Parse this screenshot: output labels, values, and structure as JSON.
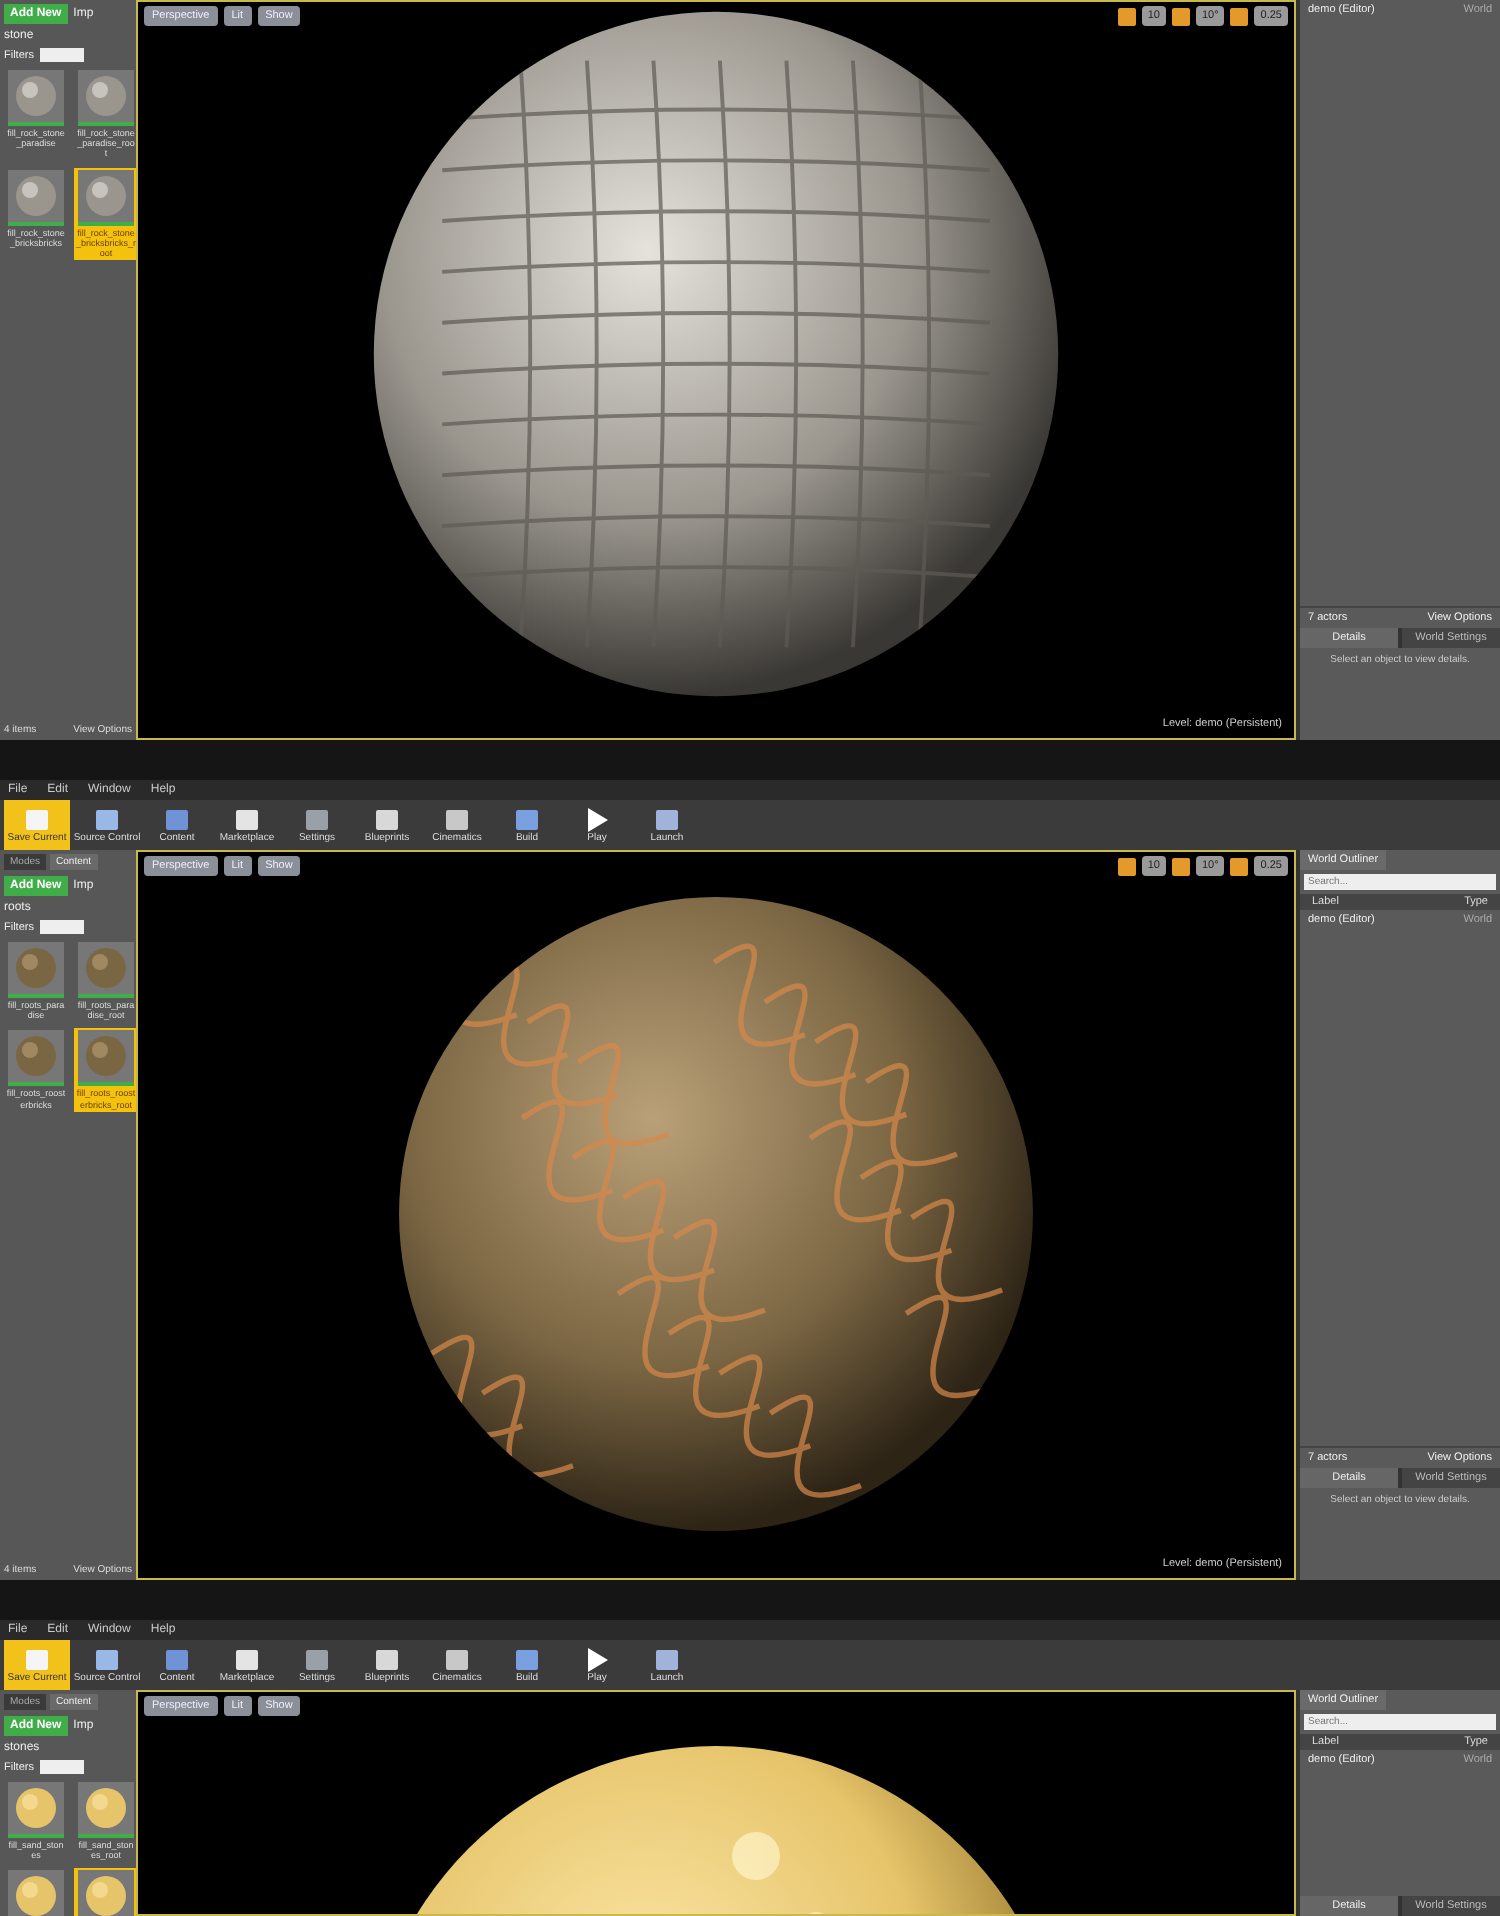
{
  "panels": [
    {
      "content_browser": {
        "add_new": "Add New",
        "import": "Imp",
        "folder": "stone",
        "filters": "Filters",
        "assets": [
          {
            "name": "fill_rock_stone_paradise",
            "selected": false
          },
          {
            "name": "fill_rock_stone_paradise_root",
            "selected": false
          },
          {
            "name": "fill_rock_stone_bricksbricks",
            "selected": false
          },
          {
            "name": "fill_rock_stone_bricksbricks_root",
            "selected": true
          }
        ],
        "item_count": "4 items",
        "view_options": "View Options"
      },
      "viewport": {
        "buttons": [
          "Perspective",
          "Lit",
          "Show"
        ],
        "readings": [
          "10",
          "10°",
          "0.25"
        ],
        "level": "Level:  demo (Persistent)",
        "kind": "stone"
      },
      "outliner": {
        "rows": [
          {
            "label": "demo (Editor)",
            "type": "World"
          }
        ],
        "actor_count": "7 actors",
        "view_options": "View Options",
        "tabs": [
          {
            "label": "Details",
            "selected": true
          },
          {
            "label": "World Settings",
            "selected": false
          }
        ],
        "hint": "Select an object to view details."
      }
    },
    {
      "menu": [
        "File",
        "Edit",
        "Window",
        "Help"
      ],
      "toolbar": [
        {
          "label": "Save Current",
          "highlighted": true
        },
        {
          "label": "Source Control",
          "highlighted": false
        },
        {
          "label": "Content",
          "highlighted": false
        },
        {
          "label": "Marketplace",
          "highlighted": false
        },
        {
          "label": "Settings",
          "highlighted": false
        },
        {
          "label": "Blueprints",
          "highlighted": false
        },
        {
          "label": "Cinematics",
          "highlighted": false
        },
        {
          "label": "Build",
          "highlighted": false
        },
        {
          "label": "Play",
          "highlighted": false
        },
        {
          "label": "Launch",
          "highlighted": false
        }
      ],
      "content_browser": {
        "tabs": [
          {
            "label": "Modes",
            "selected": false
          },
          {
            "label": "Content",
            "selected": true
          }
        ],
        "add_new": "Add New",
        "import": "Imp",
        "folder": "roots",
        "filters": "Filters",
        "assets": [
          {
            "name": "fill_roots_paradise",
            "selected": false
          },
          {
            "name": "fill_roots_paradise_root",
            "selected": false
          },
          {
            "name": "fill_roots_roosterbricks",
            "selected": false
          },
          {
            "name": "fill_roots_roosterbricks_root",
            "selected": true
          }
        ],
        "item_count": "4 items",
        "view_options": "View Options"
      },
      "viewport": {
        "buttons": [
          "Perspective",
          "Lit",
          "Show"
        ],
        "readings": [
          "10",
          "10°",
          "0.25"
        ],
        "level": "Level:  demo (Persistent)",
        "kind": "roots"
      },
      "outliner": {
        "title": "World Outliner",
        "placeholder": "Search...",
        "columns": [
          "Label",
          "Type"
        ],
        "rows": [
          {
            "label": "demo (Editor)",
            "type": "World"
          }
        ],
        "actor_count": "7 actors",
        "view_options": "View Options",
        "tabs": [
          {
            "label": "Details",
            "selected": true
          },
          {
            "label": "World Settings",
            "selected": false
          }
        ],
        "hint": "Select an object to view details."
      }
    },
    {
      "menu": [
        "File",
        "Edit",
        "Window",
        "Help"
      ],
      "toolbar": [
        {
          "label": "Save Current",
          "highlighted": true
        },
        {
          "label": "Source Control",
          "highlighted": false
        },
        {
          "label": "Content",
          "highlighted": false
        },
        {
          "label": "Marketplace",
          "highlighted": false
        },
        {
          "label": "Settings",
          "highlighted": false
        },
        {
          "label": "Blueprints",
          "highlighted": false
        },
        {
          "label": "Cinematics",
          "highlighted": false
        },
        {
          "label": "Build",
          "highlighted": false
        },
        {
          "label": "Play",
          "highlighted": false
        },
        {
          "label": "Launch",
          "highlighted": false
        }
      ],
      "content_browser": {
        "tabs": [
          {
            "label": "Modes",
            "selected": false
          },
          {
            "label": "Content",
            "selected": true
          }
        ],
        "add_new": "Add New",
        "import": "Imp",
        "folder": "stones",
        "filters": "Filters",
        "assets": [
          {
            "name": "fill_sand_stones",
            "selected": false
          },
          {
            "name": "fill_sand_stones_root",
            "selected": false
          },
          {
            "selected": false
          },
          {
            "selected": true
          }
        ]
      },
      "viewport": {
        "buttons": [
          "Perspective",
          "Lit",
          "Show"
        ],
        "kind": "sand"
      },
      "outliner": {
        "title": "World Outliner",
        "placeholder": "Search...",
        "columns": [
          "Label",
          "Type"
        ],
        "rows": [
          {
            "label": "demo (Editor)",
            "type": "World"
          }
        ],
        "tabs": [
          {
            "label": "Details",
            "selected": true
          },
          {
            "label": "World Settings",
            "selected": false
          }
        ]
      }
    }
  ]
}
